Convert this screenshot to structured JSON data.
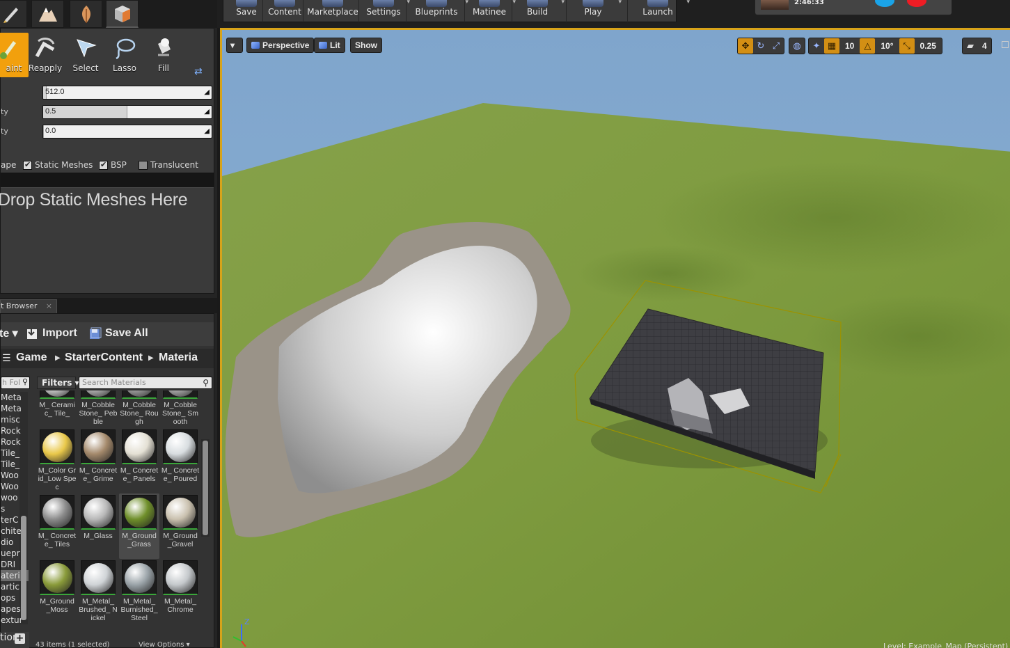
{
  "left_panel": {
    "tools": [
      {
        "label": "aint",
        "icon": "paint-brush-icon",
        "active": true
      },
      {
        "label": "Reapply",
        "icon": "reapply-icon"
      },
      {
        "label": "Select",
        "icon": "select-cursor-icon"
      },
      {
        "label": "Lasso",
        "icon": "lasso-icon"
      },
      {
        "label": "Fill",
        "icon": "fill-bucket-icon"
      }
    ],
    "properties": [
      {
        "label": "",
        "value": "512.0",
        "fill": 0.02
      },
      {
        "label": "ty",
        "value": "0.5",
        "fill": 0.5
      },
      {
        "label": "ty",
        "value": "0.0",
        "fill": 0.0
      }
    ],
    "checkbox_prefix": "ape",
    "checkboxes": [
      {
        "label": "Static Meshes",
        "checked": true
      },
      {
        "label": "BSP",
        "checked": true
      },
      {
        "label": "Translucent",
        "checked": false
      }
    ],
    "drop_text": "Drop Static Meshes Here"
  },
  "content_browser": {
    "tab_label": "t Browser",
    "tab_close": "×",
    "add_label": "te ▾",
    "import_label": "Import",
    "save_all_label": "Save All",
    "breadcrumb": [
      "Game",
      "StarterContent",
      "Materia"
    ],
    "folder_search_placeholder": "h Fol",
    "filters_label": "Filters ▾",
    "search_placeholder": "Search Materials",
    "folders": [
      "Meta",
      "Meta",
      "misc",
      "Rock",
      "Rock",
      "Tile_",
      "Tile_",
      "Woo",
      "Woo",
      "woo",
      "s",
      "terC",
      "chite",
      "dio",
      "uepr",
      "DRI",
      "ateri",
      "artic",
      "ops",
      "apes",
      "extur"
    ],
    "selected_folder_index": 16,
    "assets": [
      {
        "name": "M_ Ceramic_ Tile_",
        "color": "#d8d8d8"
      },
      {
        "name": "M_Cobble Stone_ Pebble",
        "color": "#bdbdbd"
      },
      {
        "name": "M_Cobble Stone_ Rough",
        "color": "#a8a8a8"
      },
      {
        "name": "M_Cobble Stone_ Smooth",
        "color": "#b6b6b6"
      },
      {
        "name": "M_Color Grid_Low Spec",
        "color": "#e9c84a"
      },
      {
        "name": "M_ Concrete_ Grime",
        "color": "#a58a6c"
      },
      {
        "name": "M_ Concrete_ Panels",
        "color": "#e4e0d4"
      },
      {
        "name": "M_ Concrete_ Poured",
        "color": "#d8dde0"
      },
      {
        "name": "M_ Concrete_ Tiles",
        "color": "#8c8c8c"
      },
      {
        "name": "M_Glass",
        "color": "#b8b8b8"
      },
      {
        "name": "M_Ground _Grass",
        "color": "#6f8f2a"
      },
      {
        "name": "M_Ground _Gravel",
        "color": "#c9c0ae"
      },
      {
        "name": "M_Ground _Moss",
        "color": "#8a9b3a"
      },
      {
        "name": "M_Metal_ Brushed_ Nickel",
        "color": "#cfd3d6"
      },
      {
        "name": "M_Metal_ Burnished_ Steel",
        "color": "#9aa3a8"
      },
      {
        "name": "M_Metal_ Chrome",
        "color": "#c4c8cb"
      }
    ],
    "selected_asset_index": 10,
    "status": "43 items (1 selected)",
    "view_options": "View Options ▾",
    "bottom_label": "tion"
  },
  "toolbar": {
    "buttons": [
      {
        "label": "Save",
        "dropdown": false
      },
      {
        "label": "Content",
        "dropdown": false
      },
      {
        "label": "Marketplace",
        "dropdown": false
      },
      {
        "label": "Settings",
        "dropdown": true
      },
      {
        "label": "Blueprints",
        "dropdown": true
      },
      {
        "label": "Matinee",
        "dropdown": true
      },
      {
        "label": "Build",
        "dropdown": true
      },
      {
        "label": "Play",
        "dropdown": true
      },
      {
        "label": "Launch",
        "dropdown": true
      }
    ],
    "clock": "2:46:33"
  },
  "viewport": {
    "menu_arrow": "▾",
    "perspective_label": "Perspective",
    "lit_label": "Lit",
    "show_label": "Show",
    "grid_snap": "10",
    "rotation_snap": "10°",
    "scale_snap": "0.25",
    "camera_speed": "4",
    "axis_z": "Z",
    "level_label": "Level: Example_Map (Persistent)"
  },
  "colors": {
    "accent": "#d7a31a",
    "paint_active": "#f2a00d",
    "grass": "#7e9b3f",
    "sky": "#7aa3ca"
  }
}
